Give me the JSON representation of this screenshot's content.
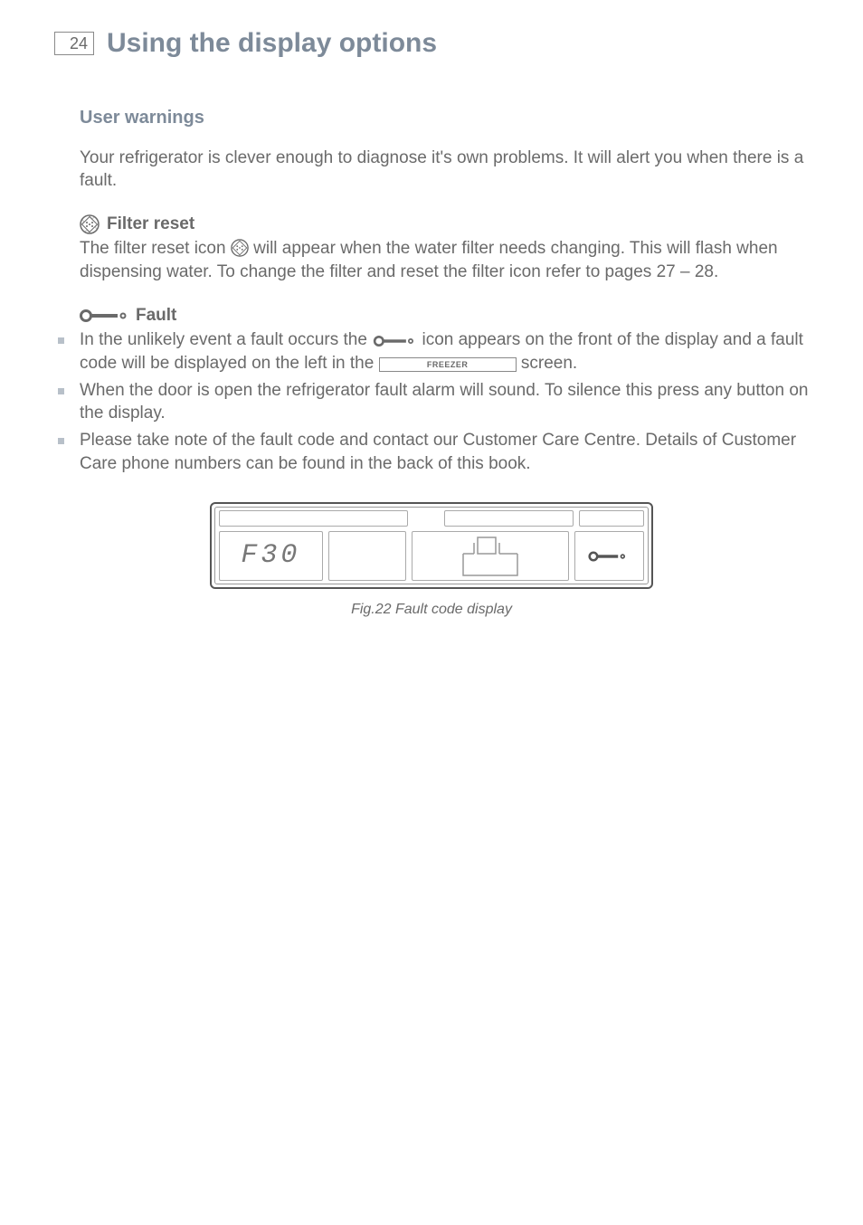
{
  "page_number": "24",
  "title": "Using the display options",
  "section": "User warnings",
  "intro": "Your refrigerator is clever enough to diagnose it's own problems. It will alert you when there is a fault.",
  "filter_reset": {
    "heading": "Filter reset",
    "icon": "filter-reset-icon",
    "text_before": "The filter reset icon ",
    "text_after": " will appear when the water filter needs changing. This will flash when dispensing water. To change the filter and reset the filter icon refer to pages 27 – 28."
  },
  "fault": {
    "heading": "Fault",
    "icon": "fault-key-icon",
    "bullets": [
      {
        "pre": "In the unlikely event a fault occurs the ",
        "mid_icon": "fault-key-icon",
        "mid1": " icon appears on the front of the display and a fault code will be displayed on the left in the ",
        "freezer_label": "FREEZER",
        "post": " screen."
      },
      {
        "text": "When the door is open the refrigerator fault alarm will sound. To silence this press any button on the display."
      },
      {
        "text": "Please take note of the fault code and contact our Customer Care Centre. Details of Customer Care phone numbers can be found in the back of this book."
      }
    ]
  },
  "figure": {
    "fault_code": "F30",
    "caption": "Fig.22 Fault code display"
  }
}
